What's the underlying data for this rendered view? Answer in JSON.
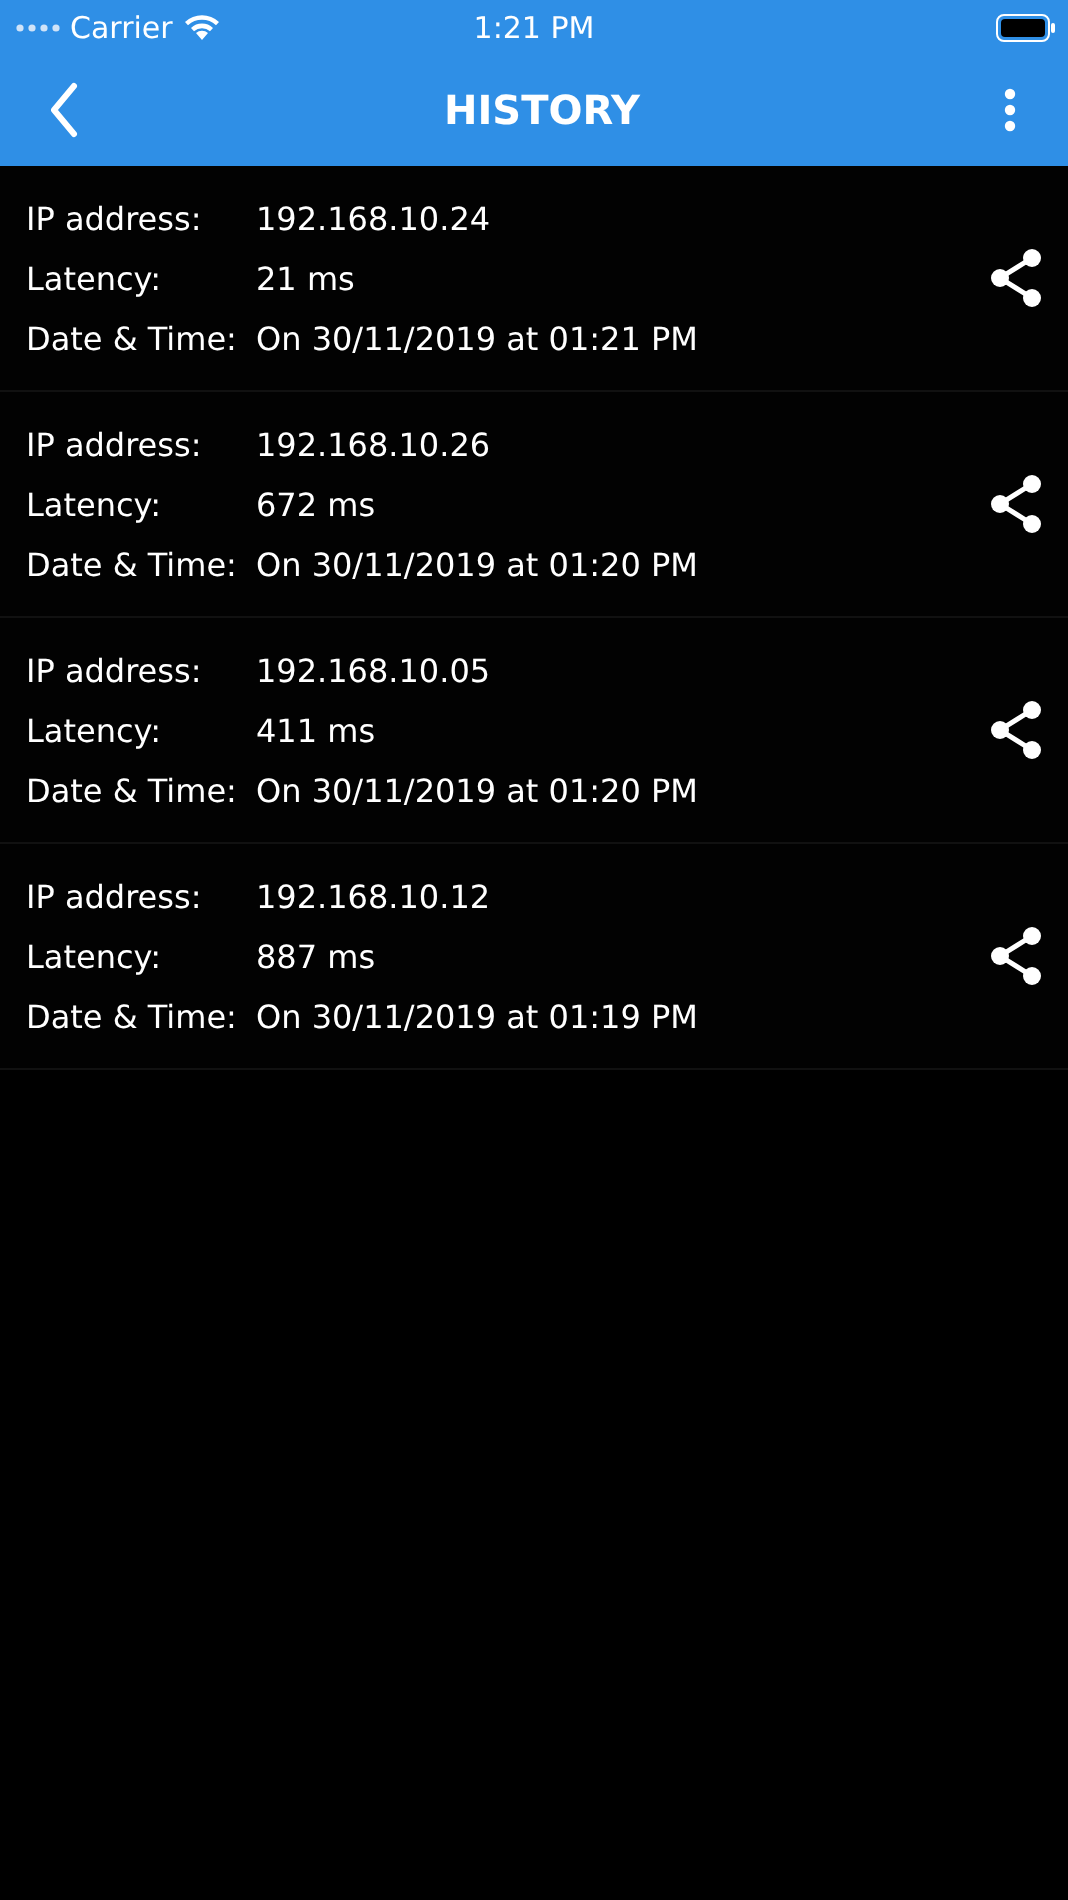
{
  "status_bar": {
    "carrier": "Carrier",
    "time": "1:21 PM"
  },
  "nav_bar": {
    "title": "HISTORY"
  },
  "history": [
    {
      "fields": [
        {
          "label": "IP address:",
          "value": "192.168.10.24"
        },
        {
          "label": "Latency:",
          "value": "21 ms"
        },
        {
          "label": "Date & Time:",
          "value": "On 30/11/2019 at 01:21 PM"
        }
      ]
    },
    {
      "fields": [
        {
          "label": "IP address:",
          "value": "192.168.10.26"
        },
        {
          "label": "Latency:",
          "value": "672 ms"
        },
        {
          "label": "Date & Time:",
          "value": "On 30/11/2019 at 01:20 PM"
        }
      ]
    },
    {
      "fields": [
        {
          "label": "IP address:",
          "value": "192.168.10.05"
        },
        {
          "label": "Latency:",
          "value": "411 ms"
        },
        {
          "label": "Date & Time:",
          "value": "On 30/11/2019 at 01:20 PM"
        }
      ]
    },
    {
      "fields": [
        {
          "label": "IP address:",
          "value": "192.168.10.12"
        },
        {
          "label": "Latency:",
          "value": "887 ms"
        },
        {
          "label": "Date & Time:",
          "value": "On 30/11/2019 at 01:19 PM"
        }
      ]
    }
  ]
}
